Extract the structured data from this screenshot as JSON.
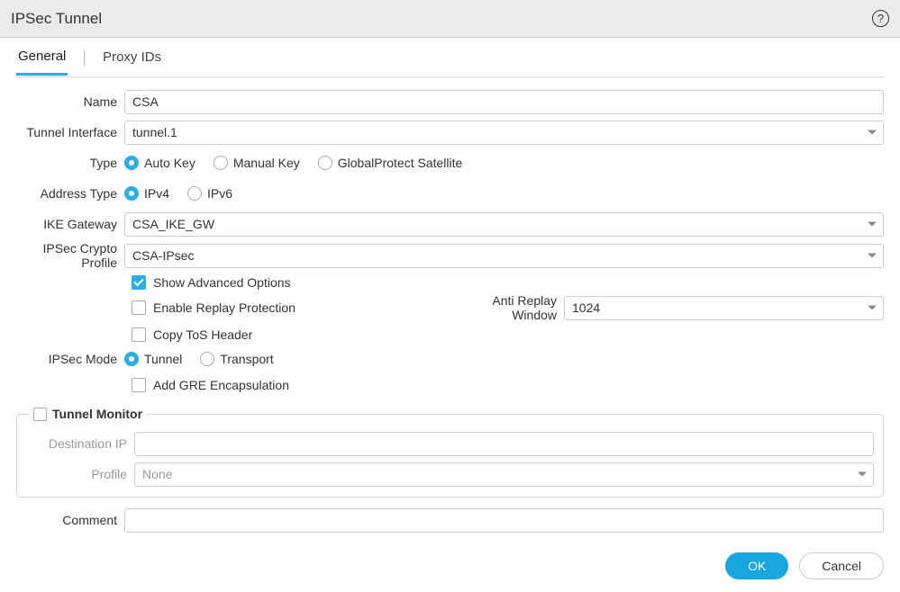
{
  "header": {
    "title": "IPSec Tunnel"
  },
  "tabs": {
    "general": "General",
    "proxy": "Proxy IDs"
  },
  "labels": {
    "name": "Name",
    "tunnel_interface": "Tunnel Interface",
    "type": "Type",
    "address_type": "Address Type",
    "ike_gateway": "IKE Gateway",
    "ipsec_profile": "IPSec Crypto Profile",
    "ipsec_mode": "IPSec Mode",
    "anti_replay": "Anti Replay Window",
    "dest_ip": "Destination IP",
    "profile": "Profile",
    "comment": "Comment",
    "tunnel_monitor": "Tunnel Monitor"
  },
  "values": {
    "name": "CSA",
    "tunnel_interface": "tunnel.1",
    "ike_gateway": "CSA_IKE_GW",
    "ipsec_profile": "CSA-IPsec",
    "anti_replay": "1024",
    "profile": "None",
    "dest_ip": "",
    "comment": ""
  },
  "radios": {
    "type": {
      "auto": "Auto Key",
      "manual": "Manual Key",
      "gp": "GlobalProtect Satellite"
    },
    "addr": {
      "ipv4": "IPv4",
      "ipv6": "IPv6"
    },
    "mode": {
      "tunnel": "Tunnel",
      "transport": "Transport"
    }
  },
  "checks": {
    "show_adv": "Show Advanced Options",
    "replay": "Enable Replay Protection",
    "tos": "Copy ToS Header",
    "gre": "Add GRE Encapsulation"
  },
  "buttons": {
    "ok": "OK",
    "cancel": "Cancel"
  }
}
